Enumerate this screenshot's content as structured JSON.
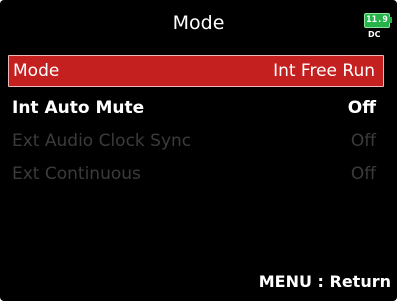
{
  "header": {
    "title": "Mode",
    "battery_level": "11.9",
    "power_source": "DC",
    "battery_color": "#26b34a"
  },
  "menu": {
    "items": [
      {
        "label": "Mode",
        "value": "Int Free Run",
        "state": "selected"
      },
      {
        "label": "Int Auto Mute",
        "value": "Off",
        "state": "enabled"
      },
      {
        "label": "Ext Audio Clock Sync",
        "value": "Off",
        "state": "disabled"
      },
      {
        "label": "Ext Continuous",
        "value": "Off",
        "state": "disabled"
      }
    ],
    "selected_color": "#c42020"
  },
  "footer": {
    "hint": "MENU : Return"
  }
}
